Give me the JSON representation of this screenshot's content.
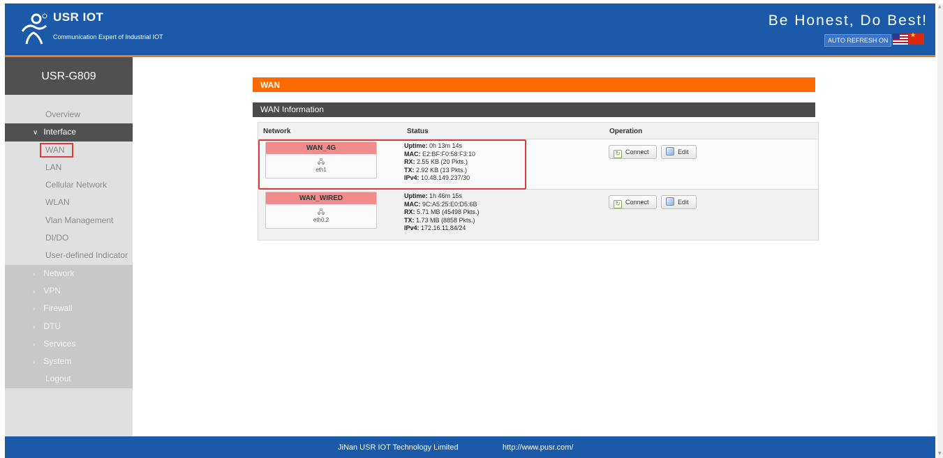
{
  "header": {
    "brand": "USR IOT",
    "tagline": "Communication Expert of Industrial IOT",
    "slogan": "Be Honest, Do Best!",
    "auto_refresh": "AUTO REFRESH ON"
  },
  "sidebar": {
    "device": "USR-G809",
    "items": [
      {
        "label": "Overview"
      },
      {
        "label": "Interface"
      },
      {
        "label": "WAN"
      },
      {
        "label": "LAN"
      },
      {
        "label": "Cellular Network"
      },
      {
        "label": "WLAN"
      },
      {
        "label": "Vlan Management"
      },
      {
        "label": "DI/DO"
      },
      {
        "label": "User-defined Indicator"
      },
      {
        "label": "Network"
      },
      {
        "label": "VPN"
      },
      {
        "label": "Firewall"
      },
      {
        "label": "DTU"
      },
      {
        "label": "Services"
      },
      {
        "label": "System"
      },
      {
        "label": "Logout"
      }
    ]
  },
  "main": {
    "section_title": "WAN",
    "panel_title": "WAN Information",
    "columns": [
      "Network",
      "Status",
      "Operation"
    ],
    "rows": [
      {
        "name": "WAN_4G",
        "device": "eth1",
        "uptime_label": "Uptime:",
        "uptime": " 0h 13m 14s",
        "mac_label": "MAC:",
        "mac": " E2:BF:F0:58:F3:10",
        "rx_label": "RX:",
        "rx": " 2.55 KB (20 Pkts.)",
        "tx_label": "TX:",
        "tx": " 2.92 KB (13 Pkts.)",
        "ipv4_label": "IPv4:",
        "ipv4": " 10.48.149.237/30",
        "connect": "Connect",
        "edit": "Edit"
      },
      {
        "name": "WAN_WIRED",
        "device": "eth0.2",
        "uptime_label": "Uptime:",
        "uptime": " 1h 46m 15s",
        "mac_label": "MAC:",
        "mac": " 9C:A5:25:E0:D5:6B",
        "rx_label": "RX:",
        "rx": " 5.71 MB (45498 Pkts.)",
        "tx_label": "TX:",
        "tx": " 1.73 MB (8858 Pkts.)",
        "ipv4_label": "IPv4:",
        "ipv4": " 172.16.11.84/24",
        "connect": "Connect",
        "edit": "Edit"
      }
    ]
  },
  "footer": {
    "company": "JiNan USR IOT Technology Limited",
    "url": "http://www.pusr.com/"
  },
  "colors": {
    "header_blue": "#1a5aa8",
    "accent_orange": "#ff6a00",
    "sidebar_dark": "#505050",
    "network_header_pink": "#f08c8c",
    "highlight_red": "#e0393b"
  },
  "icons": [
    "usr-logo-icon",
    "us-flag-icon",
    "cn-flag-icon",
    "network-adapter-icon",
    "connect-icon",
    "edit-icon",
    "chevron-right-icon",
    "chevron-down-icon"
  ]
}
